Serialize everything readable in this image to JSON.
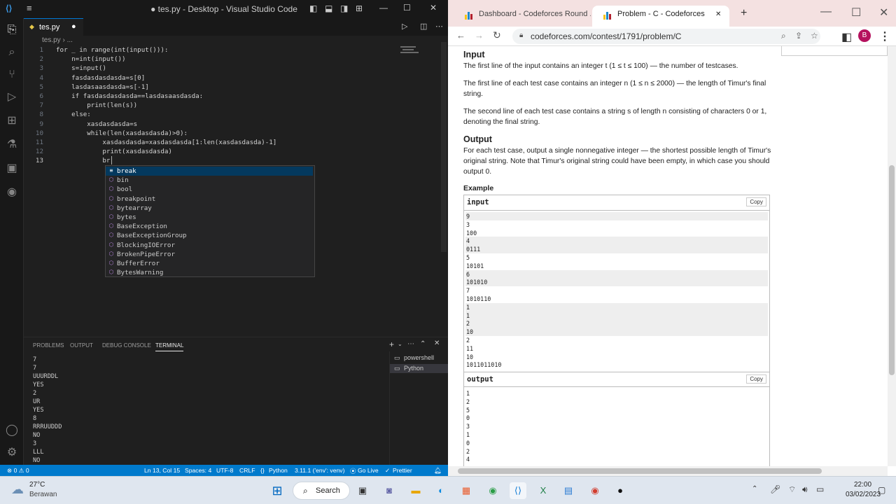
{
  "vscode": {
    "title": "● tes.py - Desktop - Visual Studio Code",
    "tab": {
      "label": "tes.py",
      "dirty": "●"
    },
    "breadcrumb": "tes.py › ...",
    "lines": [
      {
        "n": "1",
        "text": "for _ in range(int(input())):"
      },
      {
        "n": "2",
        "text": "    n=int(input())"
      },
      {
        "n": "3",
        "text": "    s=input()"
      },
      {
        "n": "4",
        "text": "    fasdasdasdasda=s[0]"
      },
      {
        "n": "5",
        "text": "    lasdasaasdasda=s[-1]"
      },
      {
        "n": "6",
        "text": "    if fasdasdasdasda==lasdasaasdasda:"
      },
      {
        "n": "7",
        "text": "        print(len(s))"
      },
      {
        "n": "8",
        "text": "    else:"
      },
      {
        "n": "9",
        "text": "        xasdasdasda=s"
      },
      {
        "n": "10",
        "text": "        while(len(xasdasdasda)>0):"
      },
      {
        "n": "11",
        "text": "            xasdasdasda=xasdasdasda[1:len(xasdasdasda)-1]"
      },
      {
        "n": "12",
        "text": "            print(xasdasdasda)"
      },
      {
        "n": "13",
        "text": "            br"
      }
    ],
    "suggestions": [
      "break",
      "bin",
      "bool",
      "breakpoint",
      "bytearray",
      "bytes",
      "BaseException",
      "BaseExceptionGroup",
      "BlockingIOError",
      "BrokenPipeError",
      "BufferError",
      "BytesWarning"
    ],
    "panel_tabs": [
      "PROBLEMS",
      "OUTPUT",
      "DEBUG CONSOLE",
      "TERMINAL"
    ],
    "terminal": [
      "7",
      "7",
      "UUURDDL",
      "YES",
      "2",
      "UR",
      "YES",
      "8",
      "RRRUUDDD",
      "NO",
      "3",
      "LLL",
      "NO"
    ],
    "terminals": [
      "powershell",
      "Python"
    ],
    "status": {
      "errors": "⊗ 0 ⚠ 0",
      "position": "Ln 13, Col 15",
      "spaces": "Spaces: 4",
      "encoding": "UTF-8",
      "eol": "CRLF",
      "language": "Python",
      "interpreter": "3.11.1 ('env': venv)",
      "golive": "Go Live",
      "prettier": "Prettier"
    }
  },
  "chrome": {
    "tabs": [
      "Dashboard - Codeforces Round ...",
      "Problem - C - Codeforces"
    ],
    "url": "codeforces.com/contest/1791/problem/C",
    "profile": "B",
    "input_heading": "Input",
    "input_p1": "The first line of the input contains an integer t (1 ≤ t ≤ 100) — the number of testcases.",
    "input_p2": "The first line of each test case contains an integer n (1 ≤ n ≤ 2000) — the length of Timur's final string.",
    "input_p3": "The second line of each test case contains a string s of length n consisting of characters 0 or 1, denoting the final string.",
    "output_heading": "Output",
    "output_p": "For each test case, output a single nonnegative integer — the shortest possible length of Timur's original string. Note that Timur's original string could have been empty, in which case you should output 0.",
    "example_heading": "Example",
    "input_label": "input",
    "output_label": "output",
    "copy_label": "Copy",
    "input_lines": [
      "9",
      "3",
      "100",
      "4",
      "0111",
      "5",
      "10101",
      "6",
      "101010",
      "7",
      "1010110",
      "1",
      "1",
      "2",
      "10",
      "2",
      "11",
      "10",
      "1011011010"
    ],
    "output_lines": [
      "1",
      "2",
      "5",
      "0",
      "3",
      "1",
      "0",
      "2",
      "4"
    ]
  },
  "taskbar": {
    "weather_temp": "27°C",
    "weather_desc": "Berawan",
    "search": "Search",
    "time": "22:00",
    "date": "03/02/2023"
  }
}
